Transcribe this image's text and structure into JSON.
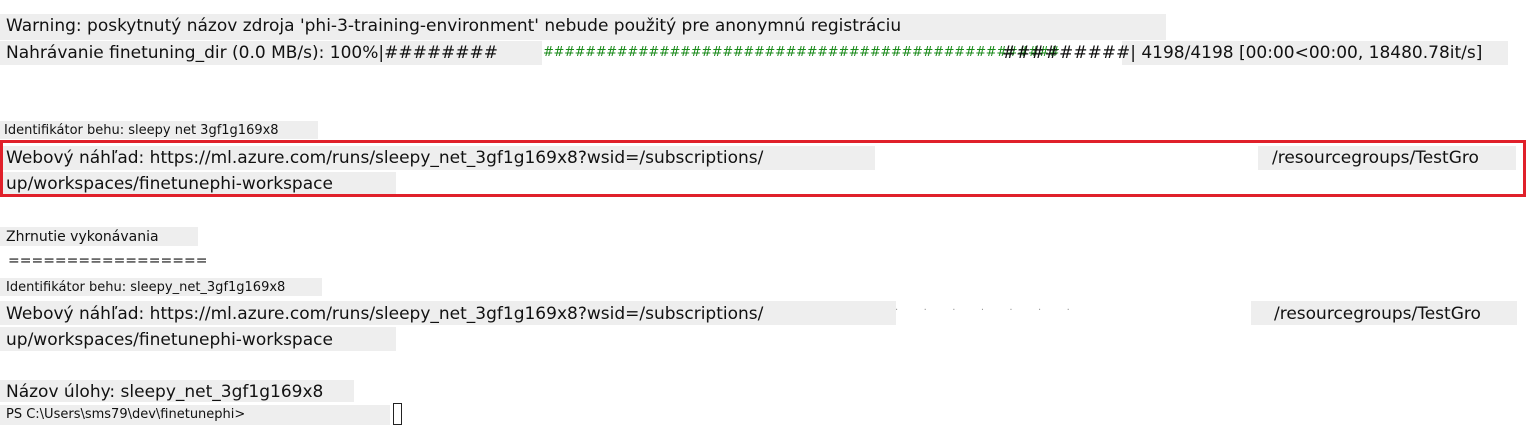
{
  "terminal": {
    "warning_line": "Warning: poskytnutý názov zdroja 'phi-3-training-environment' nebude použitý pre anonymnú registráciu",
    "upload_prefix": "Nahrávanie finetuning_dir (0.0 MB/s): 100%|########",
    "upload_bar_green": "#################################################",
    "upload_bar_tail": "#########| 4198/4198 [00:00<00:00, 18480.78it/s]",
    "upload_progress": 1.0,
    "run_id_line": "Identifikátor behu: sleepy net 3gf1g169x8",
    "web_view_1_part1": "Webový náhľad: https://ml.azure.com/runs/sleepy_net_3gf1g169x8?wsid=/subscriptions/",
    "web_view_1_part2": "/resourcegroups/TestGro",
    "web_view_1_line2": "up/workspaces/finetunephi-workspace",
    "summary_title": "Zhrnutie vykonávania",
    "summary_rule": "=================",
    "run_id_line_2": "Identifikátor behu: sleepy_net_3gf1g169x8",
    "web_view_2_part1": "Webový náhľad: https://ml.azure.com/runs/sleepy_net_3gf1g169x8?wsid=/subscriptions/",
    "web_view_2_part2": "/resourcegroups/TestGro",
    "web_view_2_line2": "up/workspaces/finetunephi-workspace",
    "job_name_line": "Názov úlohy: sleepy_net_3gf1g169x8",
    "prompt": "PS C:\\Users\\sms79\\dev\\finetunephi>"
  },
  "colors": {
    "highlight_border": "#e0202a",
    "progress_green": "#1a8a1a",
    "line_background": "#eeeeee"
  }
}
